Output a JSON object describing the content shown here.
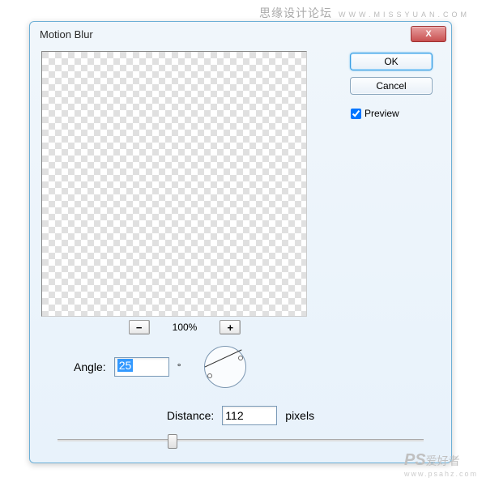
{
  "watermark": {
    "top_cn": "思缘设计论坛",
    "top_url": "WWW.MISSYUAN.COM",
    "ps": "PS",
    "ps_cn": "爱好者",
    "ps_site": "www.psahz.com"
  },
  "dialog": {
    "title": "Motion Blur",
    "close": "X",
    "ok": "OK",
    "cancel": "Cancel",
    "preview_label": "Preview",
    "preview_checked": true,
    "zoom": {
      "minus": "−",
      "level": "100%",
      "plus": "+"
    },
    "angle": {
      "label": "Angle:",
      "value": "25",
      "deg": "°"
    },
    "distance": {
      "label": "Distance:",
      "value": "112",
      "unit": "pixels"
    }
  }
}
